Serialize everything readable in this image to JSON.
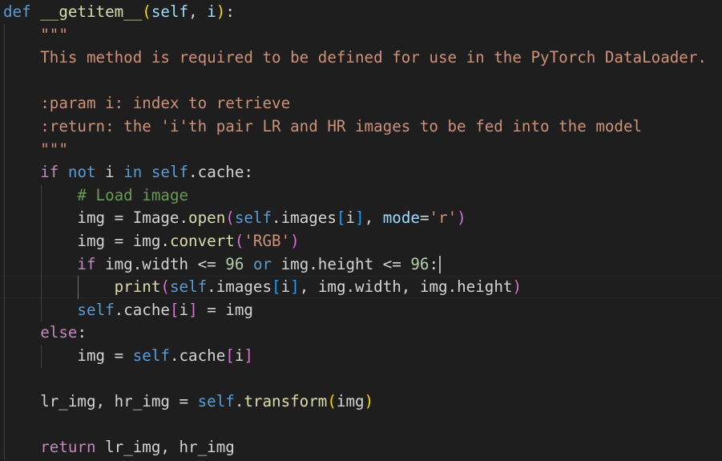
{
  "editor": {
    "language": "python",
    "theme": "dark",
    "cursor_line": 12,
    "lines": [
      {
        "tokens": [
          {
            "t": "def",
            "c": "kw"
          },
          {
            "t": " "
          },
          {
            "t": "__getitem__",
            "c": "fn"
          },
          {
            "t": "(",
            "c": "b1"
          },
          {
            "t": "self",
            "c": "par"
          },
          {
            "t": ", "
          },
          {
            "t": "i",
            "c": "par"
          },
          {
            "t": ")",
            "c": "b1"
          },
          {
            "t": ":"
          }
        ]
      },
      {
        "tokens": [
          {
            "t": "    "
          },
          {
            "t": "\"\"\"",
            "c": "str"
          }
        ]
      },
      {
        "tokens": [
          {
            "t": "    "
          },
          {
            "t": "This method is required to be defined for use in the PyTorch DataLoader.",
            "c": "str"
          }
        ]
      },
      {
        "tokens": []
      },
      {
        "tokens": [
          {
            "t": "    "
          },
          {
            "t": ":param i: index to retrieve",
            "c": "str"
          }
        ]
      },
      {
        "tokens": [
          {
            "t": "    "
          },
          {
            "t": ":return: the 'i'th pair LR and HR images to be fed into the model",
            "c": "str"
          }
        ]
      },
      {
        "tokens": [
          {
            "t": "    "
          },
          {
            "t": "\"\"\"",
            "c": "str"
          }
        ]
      },
      {
        "tokens": [
          {
            "t": "    "
          },
          {
            "t": "if",
            "c": "ctl"
          },
          {
            "t": " "
          },
          {
            "t": "not",
            "c": "kw"
          },
          {
            "t": " i "
          },
          {
            "t": "in",
            "c": "kw"
          },
          {
            "t": " "
          },
          {
            "t": "self",
            "c": "slf"
          },
          {
            "t": ".cache:"
          }
        ]
      },
      {
        "tokens": [
          {
            "t": "        "
          },
          {
            "t": "# Load image",
            "c": "cmt"
          }
        ]
      },
      {
        "tokens": [
          {
            "t": "        img = Image."
          },
          {
            "t": "open",
            "c": "fn"
          },
          {
            "t": "(",
            "c": "b2"
          },
          {
            "t": "self",
            "c": "slf"
          },
          {
            "t": ".images"
          },
          {
            "t": "[",
            "c": "b3"
          },
          {
            "t": "i"
          },
          {
            "t": "]",
            "c": "b3"
          },
          {
            "t": ", "
          },
          {
            "t": "mode",
            "c": "par"
          },
          {
            "t": "="
          },
          {
            "t": "'r'",
            "c": "str"
          },
          {
            "t": ")",
            "c": "b2"
          }
        ]
      },
      {
        "tokens": [
          {
            "t": "        img = img."
          },
          {
            "t": "convert",
            "c": "fn"
          },
          {
            "t": "(",
            "c": "b2"
          },
          {
            "t": "'RGB'",
            "c": "str"
          },
          {
            "t": ")",
            "c": "b2"
          }
        ]
      },
      {
        "tokens": [
          {
            "t": "        "
          },
          {
            "t": "if",
            "c": "ctl"
          },
          {
            "t": " img.width <= "
          },
          {
            "t": "96",
            "c": "num"
          },
          {
            "t": " "
          },
          {
            "t": "or",
            "c": "kw"
          },
          {
            "t": " img.height <= "
          },
          {
            "t": "96",
            "c": "num"
          },
          {
            "t": ":"
          }
        ]
      },
      {
        "tokens": [
          {
            "t": "            "
          },
          {
            "t": "print",
            "c": "fn"
          },
          {
            "t": "(",
            "c": "b2"
          },
          {
            "t": "self",
            "c": "slf"
          },
          {
            "t": ".images"
          },
          {
            "t": "[",
            "c": "b3"
          },
          {
            "t": "i"
          },
          {
            "t": "]",
            "c": "b3"
          },
          {
            "t": ", img.width, img.height"
          },
          {
            "t": ")",
            "c": "b2"
          }
        ]
      },
      {
        "tokens": [
          {
            "t": "        "
          },
          {
            "t": "self",
            "c": "slf"
          },
          {
            "t": ".cache"
          },
          {
            "t": "[",
            "c": "b2"
          },
          {
            "t": "i"
          },
          {
            "t": "]",
            "c": "b2"
          },
          {
            "t": " = img"
          }
        ]
      },
      {
        "tokens": [
          {
            "t": "    "
          },
          {
            "t": "else",
            "c": "ctl"
          },
          {
            "t": ":"
          }
        ]
      },
      {
        "tokens": [
          {
            "t": "        img = "
          },
          {
            "t": "self",
            "c": "slf"
          },
          {
            "t": ".cache"
          },
          {
            "t": "[",
            "c": "b2"
          },
          {
            "t": "i"
          },
          {
            "t": "]",
            "c": "b2"
          }
        ]
      },
      {
        "tokens": []
      },
      {
        "tokens": [
          {
            "t": "    lr_img, hr_img = "
          },
          {
            "t": "self",
            "c": "slf"
          },
          {
            "t": "."
          },
          {
            "t": "transform",
            "c": "fn"
          },
          {
            "t": "(",
            "c": "b1"
          },
          {
            "t": "img"
          },
          {
            "t": ")",
            "c": "b1"
          }
        ]
      },
      {
        "tokens": []
      },
      {
        "tokens": [
          {
            "t": "    "
          },
          {
            "t": "return",
            "c": "ctl"
          },
          {
            "t": " lr_img, hr_img"
          }
        ]
      }
    ]
  }
}
